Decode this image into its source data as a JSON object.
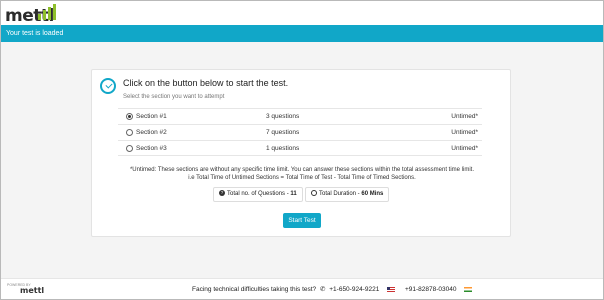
{
  "header": {
    "logo_text": "mettl",
    "status_text": "Your test is loaded"
  },
  "card": {
    "heading": "Click on the button below to start the test.",
    "subheading": "Select the section you want to attempt",
    "sections": [
      {
        "name": "Section #1",
        "questions": "3 questions",
        "timing": "Untimed*",
        "selected": true
      },
      {
        "name": "Section #2",
        "questions": "7 questions",
        "timing": "Untimed*",
        "selected": false
      },
      {
        "name": "Section #3",
        "questions": "1 questions",
        "timing": "Untimed*",
        "selected": false
      }
    ],
    "note_line1": "*Untimed: These sections are without any specific time limit. You can answer these sections within the total assessment time limit.",
    "note_line2": "i.e Total Time of Untimed Sections = Total Time of Test - Total Time of Timed Sections.",
    "total_questions_label": "Total no. of Questions - ",
    "total_questions_value": "11",
    "total_duration_label": "Total Duration - ",
    "total_duration_value": "60 Mins",
    "start_button_label": "Start Test"
  },
  "footer": {
    "powered_by": "POWERED BY",
    "logo_text": "mettl",
    "help_text": "Facing technical difficulties taking this test?",
    "phone_us": "+1-650-924-9221",
    "phone_in": "+91-82878-03040"
  },
  "colors": {
    "accent": "#11a7c8",
    "logo_green": "#8ebf2b"
  }
}
